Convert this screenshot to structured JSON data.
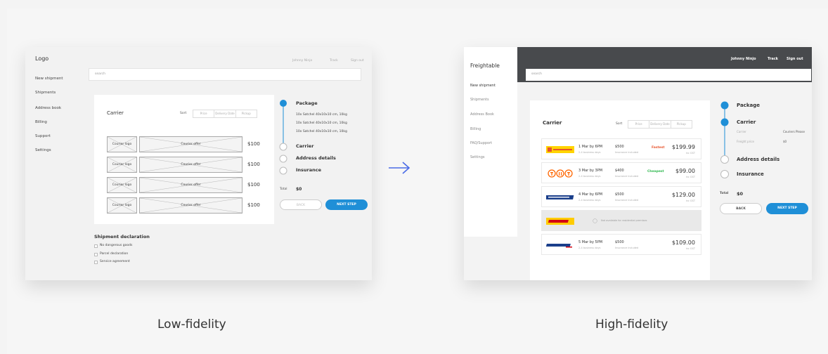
{
  "colors": {
    "accent": "#1f8fd7",
    "dark_header": "#484a4d",
    "fastest": "#e8542c",
    "cheapest": "#2fb84f",
    "arrow": "#4a6be6"
  },
  "low_fidelity": {
    "logo": "Logo",
    "nav": [
      "New shipment",
      "Shipments",
      "Address book",
      "Billing",
      "Support",
      "Settings"
    ],
    "top_links": [
      "Johnny Ninjo",
      "Track",
      "Sign out"
    ],
    "search_placeholder": "search",
    "carrier_title": "Carrier",
    "sort_label": "Sort",
    "sort_options": [
      "Price",
      "Delivery Date",
      "Pickup"
    ],
    "rows": [
      {
        "logo": "Courier logo",
        "offer": "Courier offer",
        "price": "$100"
      },
      {
        "logo": "Courier logo",
        "offer": "Courier offer",
        "price": "$100"
      },
      {
        "logo": "Courier logo",
        "offer": "Courier offer",
        "price": "$100"
      },
      {
        "logo": "Courier logo",
        "offer": "Courier offer",
        "price": "$100"
      }
    ],
    "steps": [
      "Package",
      "Carrier",
      "Address details",
      "Insurance"
    ],
    "package_items": [
      "10x Satchel 40x10x10 cm, 10kg",
      "10x Satchel 40x10x10 cm, 10kg",
      "10x Satchel 40x10x10 cm, 10kg"
    ],
    "total_label": "Total",
    "total_value": "$0",
    "back": "BACK",
    "next": "NEXT STEP",
    "declaration_title": "Shipment declaration",
    "declarations": [
      "No dangerous goods",
      "Parcel declaration",
      "Service agreement"
    ],
    "caption": "Low-fidelity"
  },
  "high_fidelity": {
    "logo": "Freightable",
    "nav": [
      "New shipment",
      "Shipments",
      "Address Book",
      "Billing",
      "FAQ/Support",
      "Settings"
    ],
    "top_links": [
      "Johnny Ninjo",
      "Track",
      "Sign out"
    ],
    "search_placeholder": "search",
    "carrier_title": "Carrier",
    "sort_label": "Sort",
    "sort_options": [
      "Price",
      "Delivery Date",
      "Pickup"
    ],
    "rows": [
      {
        "carrier": "Couriers Please",
        "time": "1 Mar by 6PM",
        "days": "2-4 business days",
        "price": "$500",
        "insurance": "Insurance included",
        "tag": "Fastest",
        "total": "$199.99",
        "gst": "inc GST"
      },
      {
        "carrier": "TNT",
        "time": "3 Mar by 3PM",
        "days": "2-4 business days",
        "price": "$400",
        "insurance": "Insurance included",
        "tag": "Cheapest",
        "total": "$99.00",
        "gst": "inc GST"
      },
      {
        "carrier": "StarTrack",
        "time": "4 Mar by 6PM",
        "days": "2-4 business days",
        "price": "$500",
        "insurance": "Insurance included",
        "tag": "",
        "total": "$129.00",
        "gst": "inc GST"
      },
      {
        "carrier": "DHL",
        "na": "Not available for residential premises"
      },
      {
        "carrier": "Fastway",
        "time": "5 Mar by 5PM",
        "days": "2-4 business days",
        "price": "$500",
        "insurance": "Insurance included",
        "tag": "",
        "total": "$109.00",
        "gst": "inc GST"
      }
    ],
    "steps": [
      "Package",
      "Carrier",
      "Address details",
      "Insurance"
    ],
    "carrier_detail_labels": [
      "Carrier",
      "Freight price"
    ],
    "carrier_detail_values": [
      "Couriers Please",
      "$0"
    ],
    "total_label": "Total",
    "total_value": "$0",
    "back": "BACK",
    "next": "NEXT STEP",
    "caption": "High-fidelity"
  }
}
